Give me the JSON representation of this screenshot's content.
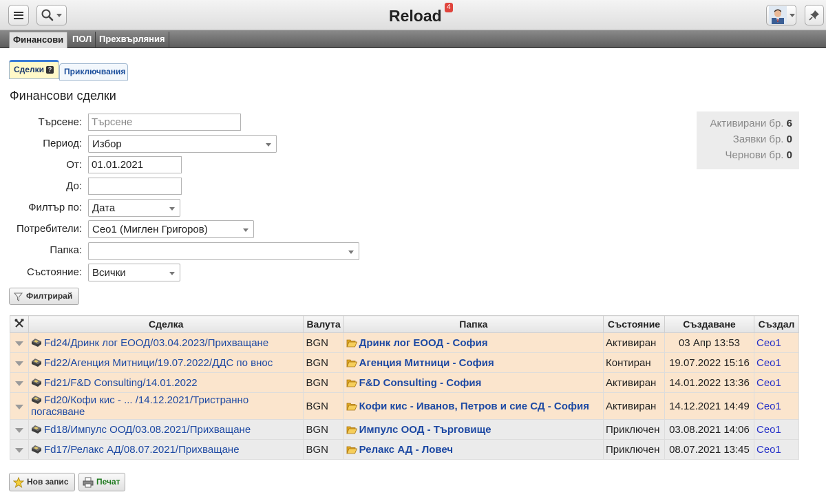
{
  "header": {
    "title": "Reload",
    "notification_count": "4"
  },
  "menu": [
    "Финансови",
    "ПОЛ",
    "Прехвърляния"
  ],
  "tabs": [
    {
      "label": "Сделки",
      "help": "?"
    },
    {
      "label": "Приключвания"
    }
  ],
  "page_title": "Финансови сделки",
  "form": {
    "search_label": "Търсене:",
    "search_placeholder": "Търсене",
    "period_label": "Период:",
    "period_value": "Избор",
    "from_label": "От:",
    "from_value": "01.01.2021",
    "to_label": "До:",
    "to_value": "",
    "filterby_label": "Филтър по:",
    "filterby_value": "Дата",
    "users_label": "Потребители:",
    "users_value": "Сео1 (Миглен Григоров)",
    "folder_label": "Папка:",
    "folder_value": "",
    "status_label": "Състояние:",
    "status_value": "Всички",
    "filter_button": "Филтрирай"
  },
  "stats": [
    {
      "label": "Активирани бр.",
      "value": "6"
    },
    {
      "label": "Заявки бр.",
      "value": "0"
    },
    {
      "label": "Чернови бр.",
      "value": "0"
    }
  ],
  "table": {
    "headers": [
      "Сделка",
      "Валута",
      "Папка",
      "Състояние",
      "Създаване",
      "Създал"
    ],
    "rows": [
      {
        "deal": "Fd24/Дринк лог ЕООД/03.04.2023/Прихващане",
        "currency": "BGN",
        "folder": "Дринк лог ЕООД - София",
        "status": "Активиран",
        "created": "03 Апр 13:53",
        "creator": "Сео1"
      },
      {
        "deal": "Fd22/Агенция Митници/19.07.2022/ДДС по внос",
        "currency": "BGN",
        "folder": "Агенция Митници - София",
        "status": "Контиран",
        "created": "19.07.2022 15:16",
        "creator": "Сео1"
      },
      {
        "deal": "Fd21/F&D Consulting/14.01.2022",
        "currency": "BGN",
        "folder": "F&D Consulting - София",
        "status": "Активиран",
        "created": "14.01.2022 13:36",
        "creator": "Сео1"
      },
      {
        "deal": "Fd20/Кофи кис - ... /14.12.2021/Тристранно погасяване",
        "currency": "BGN",
        "folder": "Кофи кис - Иванов, Петров и сие СД - София",
        "status": "Активиран",
        "created": "14.12.2021 14:49",
        "creator": "Сео1"
      },
      {
        "deal": "Fd18/Импулс ООД/03.08.2021/Прихващане",
        "currency": "BGN",
        "folder": "Импулс ООД - Търговище",
        "status": "Приключен",
        "created": "03.08.2021 14:06",
        "creator": "Сео1"
      },
      {
        "deal": "Fd17/Релакс АД/08.07.2021/Прихващане",
        "currency": "BGN",
        "folder": "Релакс АД - Ловеч",
        "status": "Приключен",
        "created": "08.07.2021 13:45",
        "creator": "Сео1"
      }
    ]
  },
  "buttons": {
    "new": "Нов запис",
    "print": "Печат"
  }
}
